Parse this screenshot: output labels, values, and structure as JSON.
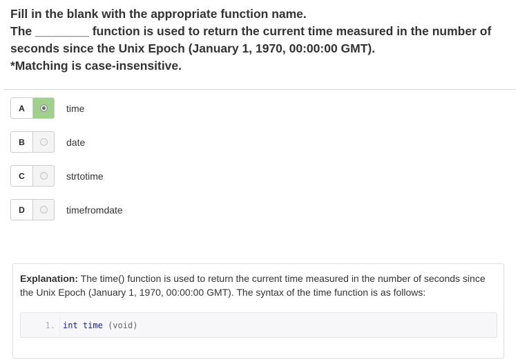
{
  "question": {
    "line1": "Fill in the blank with the appropriate function name.",
    "line2": "The ________ function is used to return the current time measured in the number of",
    "line3": "seconds since the Unix Epoch (January 1, 1970, 00:00:00 GMT).",
    "line4": "*Matching is case-insensitive."
  },
  "options": [
    {
      "letter": "A",
      "label": "time",
      "selected": true
    },
    {
      "letter": "B",
      "label": "date",
      "selected": false
    },
    {
      "letter": "C",
      "label": "strtotime",
      "selected": false
    },
    {
      "letter": "D",
      "label": "timefromdate",
      "selected": false
    }
  ],
  "explanation": {
    "heading": "Explanation:",
    "body": " The time() function is used to return the current time measured in the number of seconds since the Unix Epoch (January 1, 1970, 00:00:00 GMT). The syntax of the time function is as follows:",
    "code": {
      "line_number": "1.",
      "tokens": {
        "type": "int",
        "name": "time",
        "open": "(",
        "arg": "void",
        "close": ")"
      }
    }
  },
  "colors": {
    "selected_accent": "#9fd18a",
    "text": "#333333",
    "code_background": "#f7f7f9"
  }
}
